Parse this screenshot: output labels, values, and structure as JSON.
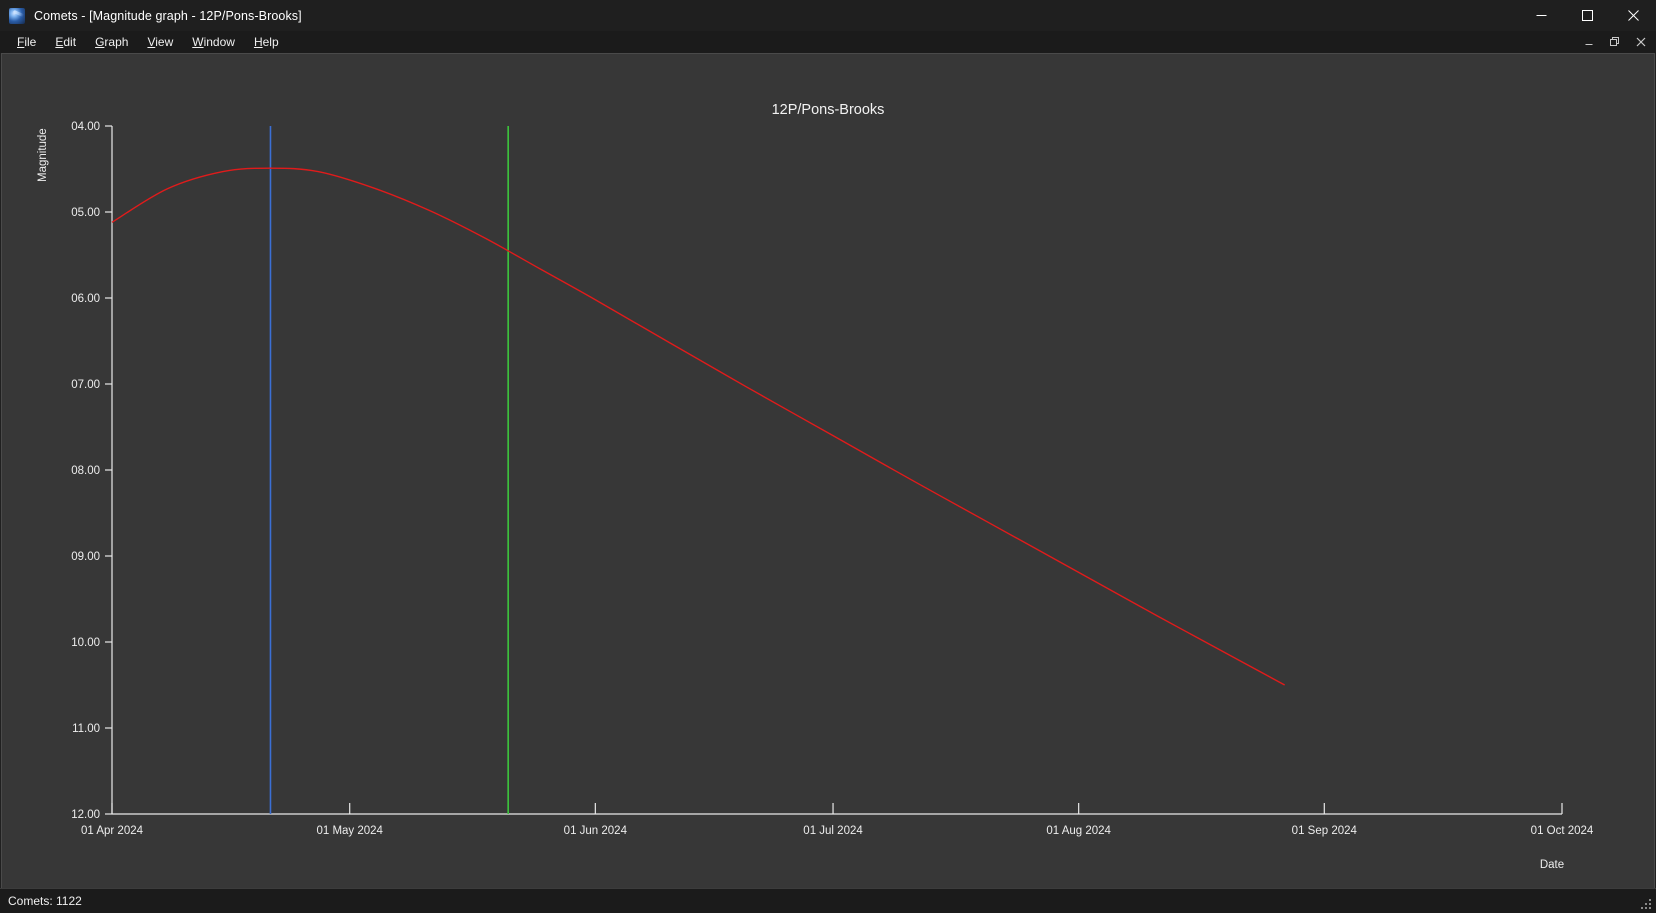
{
  "window": {
    "title": "Comets - [Magnitude graph - 12P/Pons-Brooks]",
    "app_icon": "comet-icon",
    "controls": {
      "minimize": "minimize-icon",
      "maximize": "maximize-icon",
      "close": "close-icon"
    },
    "mdi_controls": {
      "minimize": "mdi-minimize-icon",
      "restore": "mdi-restore-icon",
      "close": "mdi-close-icon"
    }
  },
  "menu": {
    "items": [
      {
        "label": "File",
        "accel": "F"
      },
      {
        "label": "Edit",
        "accel": "E"
      },
      {
        "label": "Graph",
        "accel": "G"
      },
      {
        "label": "View",
        "accel": "V"
      },
      {
        "label": "Window",
        "accel": "W"
      },
      {
        "label": "Help",
        "accel": "H"
      }
    ]
  },
  "status": {
    "text": "Comets: 1122"
  },
  "colors": {
    "background": "#373737",
    "axis": "#e8e8e8",
    "curve": "#e01b1b",
    "marker_blue": "#3b6fd4",
    "marker_green": "#3dc43d",
    "window_chrome": "#1f1f1f",
    "text": "#f0f0f0"
  },
  "chart_data": {
    "type": "line",
    "title": "12P/Pons-Brooks",
    "xlabel": "Date",
    "ylabel": "Magnitude",
    "grid": false,
    "legend": null,
    "y_inverted": true,
    "ylim": [
      4.0,
      12.0
    ],
    "ytick_labels": [
      "04.00",
      "05.00",
      "06.00",
      "07.00",
      "08.00",
      "09.00",
      "10.00",
      "11.00",
      "12.00"
    ],
    "yticks": [
      4,
      5,
      6,
      7,
      8,
      9,
      10,
      11,
      12
    ],
    "xlim": [
      "2024-04-01",
      "2024-10-01"
    ],
    "xtick_labels": [
      "01 Apr 2024",
      "01 May 2024",
      "01 Jun 2024",
      "01 Jul 2024",
      "01 Aug 2024",
      "01 Sep 2024",
      "01 Oct 2024"
    ],
    "xticks": [
      "2024-04-01",
      "2024-05-01",
      "2024-06-01",
      "2024-07-01",
      "2024-08-01",
      "2024-09-01",
      "2024-10-01"
    ],
    "series": [
      {
        "name": "Magnitude",
        "color": "#e01b1b",
        "x": [
          "2024-04-01",
          "2024-04-08",
          "2024-04-15",
          "2024-04-21",
          "2024-04-27",
          "2024-05-04",
          "2024-05-11",
          "2024-05-18",
          "2024-05-25",
          "2024-06-01",
          "2024-06-10",
          "2024-06-20",
          "2024-07-01",
          "2024-07-11",
          "2024-07-21",
          "2024-08-01",
          "2024-08-11",
          "2024-08-21",
          "2024-08-27"
        ],
        "y": [
          5.12,
          4.73,
          4.53,
          4.49,
          4.53,
          4.72,
          4.98,
          5.3,
          5.66,
          6.02,
          6.5,
          7.03,
          7.6,
          8.12,
          8.63,
          9.19,
          9.7,
          10.2,
          10.5
        ]
      }
    ],
    "markers": [
      {
        "name": "perihelion-marker",
        "color": "#3b6fd4",
        "x": "2024-04-21"
      },
      {
        "name": "today-marker",
        "color": "#3dc43d",
        "x": "2024-05-21"
      }
    ]
  }
}
